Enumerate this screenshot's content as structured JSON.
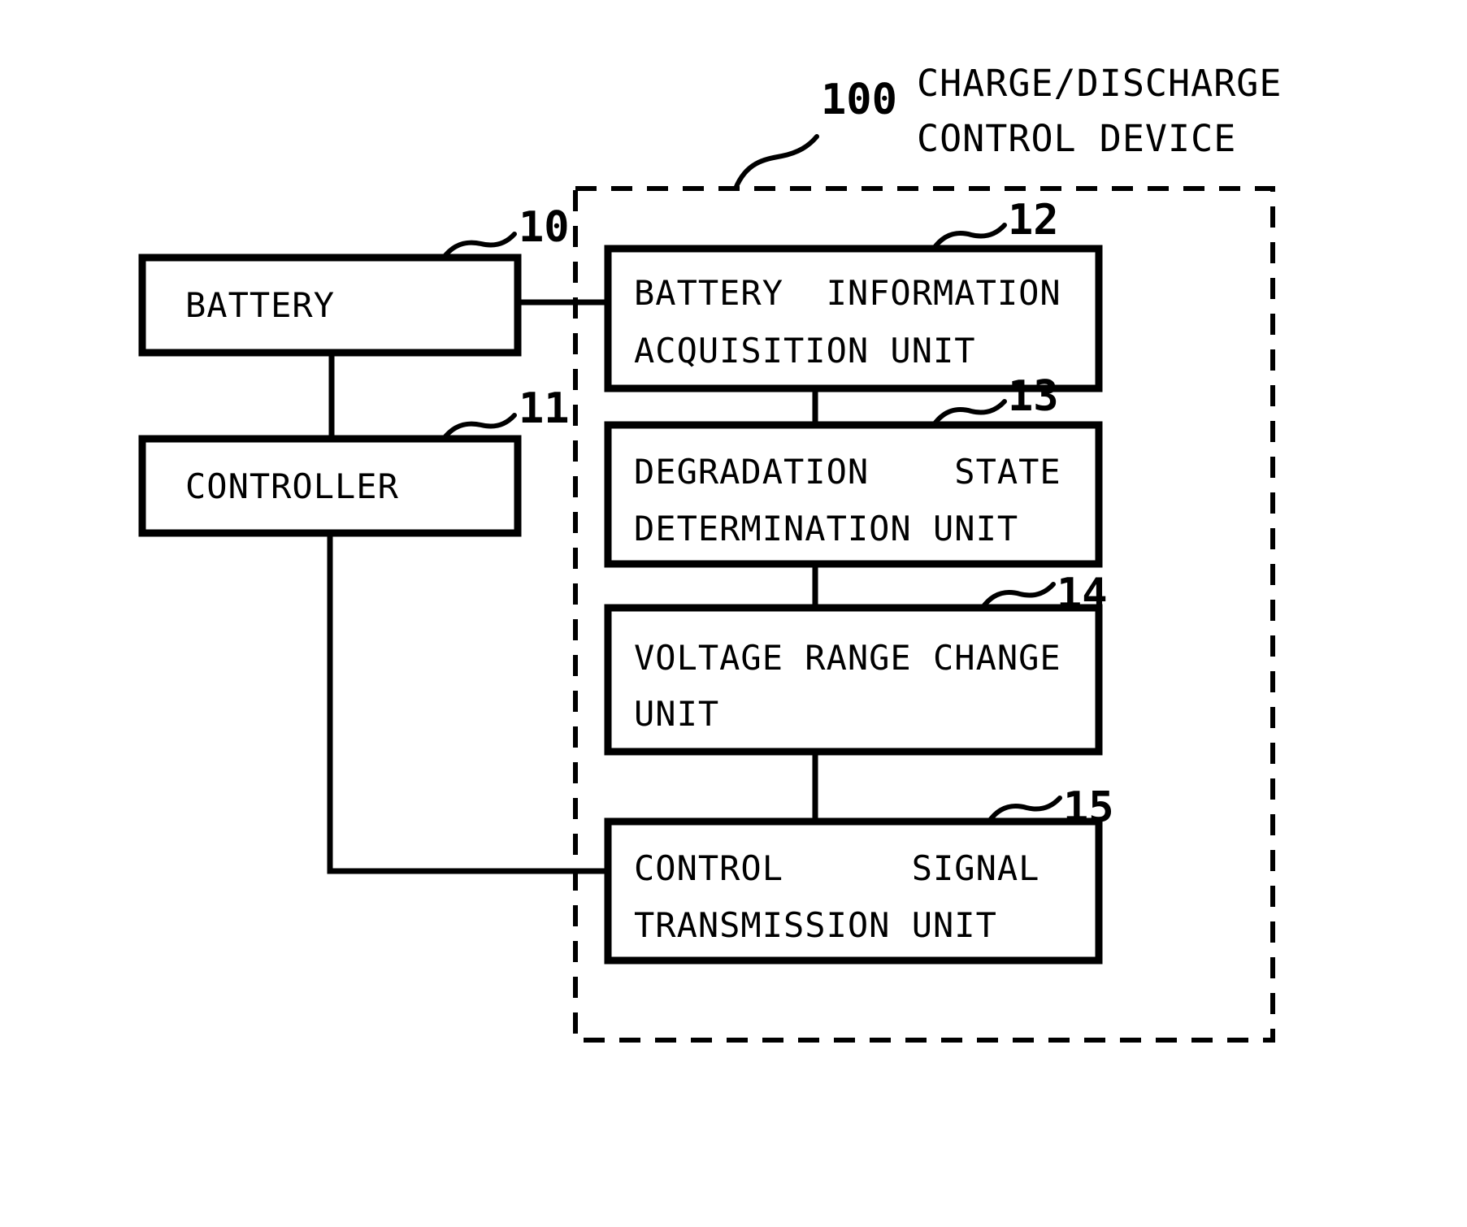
{
  "figure": {
    "kind": "patent-block-diagram",
    "title_lines": [
      "CHARGE/DISCHARGE",
      "CONTROL DEVICE"
    ],
    "title_ref": "100",
    "colors": {
      "line": "#000000",
      "background": "#ffffff",
      "box_fill": "#ffffff"
    }
  },
  "blocks": [
    {
      "id": "battery",
      "ref": "10",
      "lines": [
        "BATTERY"
      ],
      "align": "left"
    },
    {
      "id": "controller",
      "ref": "11",
      "lines": [
        "CONTROLLER"
      ],
      "align": "left"
    },
    {
      "id": "battery-information-acquisition-unit",
      "ref": "12",
      "lines": [
        "BATTERY  INFORMATION",
        "ACQUISITION UNIT"
      ],
      "align": "left"
    },
    {
      "id": "degradation-state-determination-unit",
      "ref": "13",
      "lines": [
        "DEGRADATION    STATE",
        "DETERMINATION UNIT"
      ],
      "align": "left"
    },
    {
      "id": "voltage-range-change-unit",
      "ref": "14",
      "lines": [
        "VOLTAGE RANGE CHANGE",
        "UNIT"
      ],
      "align": "left"
    },
    {
      "id": "control-signal-transmission-unit",
      "ref": "15",
      "lines": [
        "CONTROL      SIGNAL",
        "TRANSMISSION UNIT"
      ],
      "align": "left"
    }
  ],
  "connections": [
    {
      "from": "battery",
      "to": "battery-information-acquisition-unit"
    },
    {
      "from": "battery",
      "to": "controller"
    },
    {
      "from": "battery-information-acquisition-unit",
      "to": "degradation-state-determination-unit"
    },
    {
      "from": "degradation-state-determination-unit",
      "to": "voltage-range-change-unit"
    },
    {
      "from": "voltage-range-change-unit",
      "to": "control-signal-transmission-unit"
    },
    {
      "from": "control-signal-transmission-unit",
      "to": "controller"
    }
  ],
  "text": {
    "battery_label": "BATTERY",
    "controller_label": "CONTROLLER",
    "b12_l1": "BATTERY  INFORMATION",
    "b12_l2": "ACQUISITION UNIT",
    "b13_l1": "DEGRADATION    STATE",
    "b13_l2": "DETERMINATION UNIT",
    "b14_l1": "VOLTAGE RANGE CHANGE",
    "b14_l2": "UNIT",
    "b15_l1": "CONTROL      SIGNAL",
    "b15_l2": "TRANSMISSION UNIT",
    "title_l1": "CHARGE/DISCHARGE",
    "title_l2": "CONTROL DEVICE",
    "ref_100": "100",
    "ref_10": "10",
    "ref_11": "11",
    "ref_12": "12",
    "ref_13": "13",
    "ref_14": "14",
    "ref_15": "15"
  }
}
